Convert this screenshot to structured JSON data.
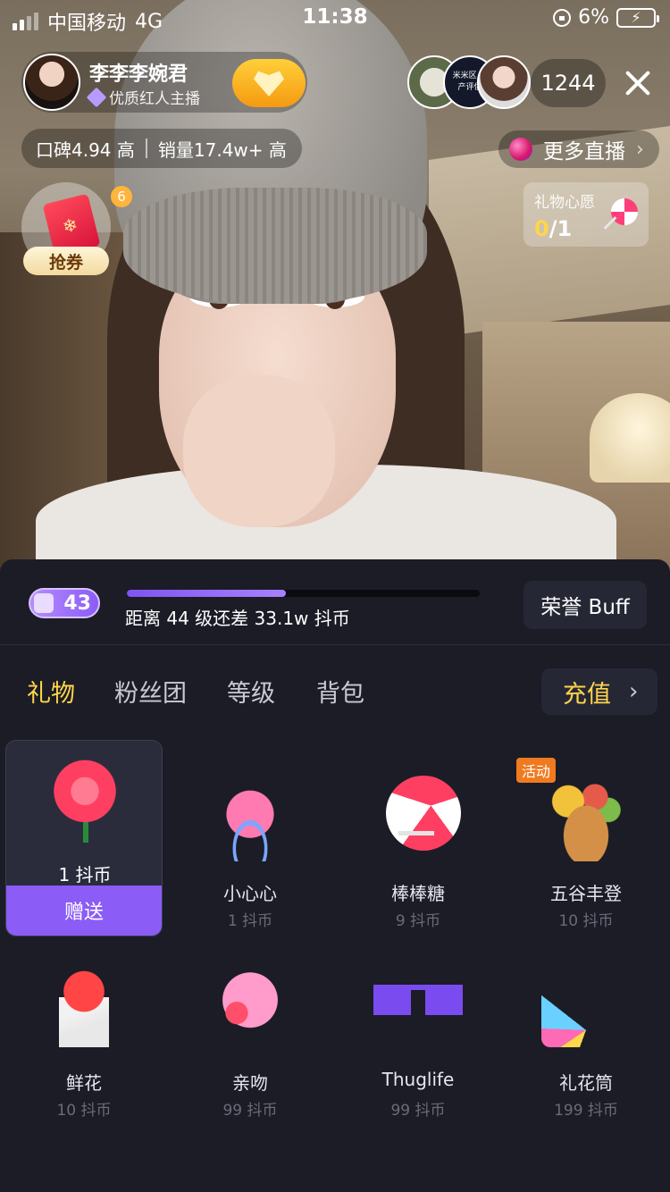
{
  "status_bar": {
    "carrier": "中国移动",
    "network": "4G",
    "time": "11:38",
    "battery": "6%"
  },
  "host": {
    "name": "李李李婉君",
    "subtitle": "优质红人主播"
  },
  "viewers": {
    "count": "1244",
    "avatar_2_text": "米米区 资产评估"
  },
  "stats": {
    "reputation": "口碑4.94 高",
    "sales": "销量17.4w+ 高"
  },
  "more_live": {
    "label": "更多直播",
    "chevron": "›"
  },
  "coupon": {
    "badge": "6",
    "label": "抢券"
  },
  "gift_wish": {
    "title": "礼物心愿",
    "current": "0",
    "total": "/1"
  },
  "level": {
    "badge": "43",
    "progress_fraction": 0.45,
    "text": "距离 44 级还差 33.1w 抖币",
    "honor_buff": "荣誉 Buff"
  },
  "tabs": [
    {
      "label": "礼物",
      "active": true
    },
    {
      "label": "粉丝团",
      "active": false
    },
    {
      "label": "等级",
      "active": false
    },
    {
      "label": "背包",
      "active": false
    }
  ],
  "recharge": {
    "label": "充值",
    "chevron": "›"
  },
  "gifts": [
    {
      "name": "",
      "price": "1 抖币",
      "selected": true,
      "send": "赠送",
      "icon": "rose"
    },
    {
      "name": "小心心",
      "price": "1 抖币",
      "icon": "heart"
    },
    {
      "name": "棒棒糖",
      "price": "9 抖币",
      "icon": "lollipop"
    },
    {
      "name": "五谷丰登",
      "price": "10 抖币",
      "tag": "活动",
      "icon": "harvest"
    },
    {
      "name": "鲜花",
      "price": "10 抖币",
      "icon": "flowers"
    },
    {
      "name": "亲吻",
      "price": "99 抖币",
      "icon": "kiss"
    },
    {
      "name": "Thuglife",
      "price": "99 抖币",
      "icon": "sunglasses"
    },
    {
      "name": "礼花筒",
      "price": "199 抖币",
      "icon": "party-popper"
    }
  ]
}
